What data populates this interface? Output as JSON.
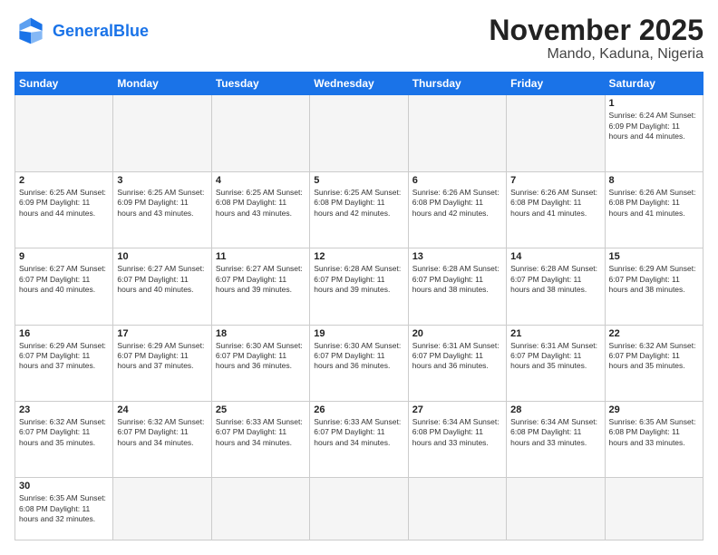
{
  "header": {
    "logo_general": "General",
    "logo_blue": "Blue",
    "month": "November 2025",
    "location": "Mando, Kaduna, Nigeria"
  },
  "days_of_week": [
    "Sunday",
    "Monday",
    "Tuesday",
    "Wednesday",
    "Thursday",
    "Friday",
    "Saturday"
  ],
  "weeks": [
    [
      {
        "day": "",
        "info": ""
      },
      {
        "day": "",
        "info": ""
      },
      {
        "day": "",
        "info": ""
      },
      {
        "day": "",
        "info": ""
      },
      {
        "day": "",
        "info": ""
      },
      {
        "day": "",
        "info": ""
      },
      {
        "day": "1",
        "info": "Sunrise: 6:24 AM\nSunset: 6:09 PM\nDaylight: 11 hours and 44 minutes."
      }
    ],
    [
      {
        "day": "2",
        "info": "Sunrise: 6:25 AM\nSunset: 6:09 PM\nDaylight: 11 hours and 44 minutes."
      },
      {
        "day": "3",
        "info": "Sunrise: 6:25 AM\nSunset: 6:09 PM\nDaylight: 11 hours and 43 minutes."
      },
      {
        "day": "4",
        "info": "Sunrise: 6:25 AM\nSunset: 6:08 PM\nDaylight: 11 hours and 43 minutes."
      },
      {
        "day": "5",
        "info": "Sunrise: 6:25 AM\nSunset: 6:08 PM\nDaylight: 11 hours and 42 minutes."
      },
      {
        "day": "6",
        "info": "Sunrise: 6:26 AM\nSunset: 6:08 PM\nDaylight: 11 hours and 42 minutes."
      },
      {
        "day": "7",
        "info": "Sunrise: 6:26 AM\nSunset: 6:08 PM\nDaylight: 11 hours and 41 minutes."
      },
      {
        "day": "8",
        "info": "Sunrise: 6:26 AM\nSunset: 6:08 PM\nDaylight: 11 hours and 41 minutes."
      }
    ],
    [
      {
        "day": "9",
        "info": "Sunrise: 6:27 AM\nSunset: 6:07 PM\nDaylight: 11 hours and 40 minutes."
      },
      {
        "day": "10",
        "info": "Sunrise: 6:27 AM\nSunset: 6:07 PM\nDaylight: 11 hours and 40 minutes."
      },
      {
        "day": "11",
        "info": "Sunrise: 6:27 AM\nSunset: 6:07 PM\nDaylight: 11 hours and 39 minutes."
      },
      {
        "day": "12",
        "info": "Sunrise: 6:28 AM\nSunset: 6:07 PM\nDaylight: 11 hours and 39 minutes."
      },
      {
        "day": "13",
        "info": "Sunrise: 6:28 AM\nSunset: 6:07 PM\nDaylight: 11 hours and 38 minutes."
      },
      {
        "day": "14",
        "info": "Sunrise: 6:28 AM\nSunset: 6:07 PM\nDaylight: 11 hours and 38 minutes."
      },
      {
        "day": "15",
        "info": "Sunrise: 6:29 AM\nSunset: 6:07 PM\nDaylight: 11 hours and 38 minutes."
      }
    ],
    [
      {
        "day": "16",
        "info": "Sunrise: 6:29 AM\nSunset: 6:07 PM\nDaylight: 11 hours and 37 minutes."
      },
      {
        "day": "17",
        "info": "Sunrise: 6:29 AM\nSunset: 6:07 PM\nDaylight: 11 hours and 37 minutes."
      },
      {
        "day": "18",
        "info": "Sunrise: 6:30 AM\nSunset: 6:07 PM\nDaylight: 11 hours and 36 minutes."
      },
      {
        "day": "19",
        "info": "Sunrise: 6:30 AM\nSunset: 6:07 PM\nDaylight: 11 hours and 36 minutes."
      },
      {
        "day": "20",
        "info": "Sunrise: 6:31 AM\nSunset: 6:07 PM\nDaylight: 11 hours and 36 minutes."
      },
      {
        "day": "21",
        "info": "Sunrise: 6:31 AM\nSunset: 6:07 PM\nDaylight: 11 hours and 35 minutes."
      },
      {
        "day": "22",
        "info": "Sunrise: 6:32 AM\nSunset: 6:07 PM\nDaylight: 11 hours and 35 minutes."
      }
    ],
    [
      {
        "day": "23",
        "info": "Sunrise: 6:32 AM\nSunset: 6:07 PM\nDaylight: 11 hours and 35 minutes."
      },
      {
        "day": "24",
        "info": "Sunrise: 6:32 AM\nSunset: 6:07 PM\nDaylight: 11 hours and 34 minutes."
      },
      {
        "day": "25",
        "info": "Sunrise: 6:33 AM\nSunset: 6:07 PM\nDaylight: 11 hours and 34 minutes."
      },
      {
        "day": "26",
        "info": "Sunrise: 6:33 AM\nSunset: 6:07 PM\nDaylight: 11 hours and 34 minutes."
      },
      {
        "day": "27",
        "info": "Sunrise: 6:34 AM\nSunset: 6:08 PM\nDaylight: 11 hours and 33 minutes."
      },
      {
        "day": "28",
        "info": "Sunrise: 6:34 AM\nSunset: 6:08 PM\nDaylight: 11 hours and 33 minutes."
      },
      {
        "day": "29",
        "info": "Sunrise: 6:35 AM\nSunset: 6:08 PM\nDaylight: 11 hours and 33 minutes."
      }
    ],
    [
      {
        "day": "30",
        "info": "Sunrise: 6:35 AM\nSunset: 6:08 PM\nDaylight: 11 hours and 32 minutes."
      },
      {
        "day": "",
        "info": ""
      },
      {
        "day": "",
        "info": ""
      },
      {
        "day": "",
        "info": ""
      },
      {
        "day": "",
        "info": ""
      },
      {
        "day": "",
        "info": ""
      },
      {
        "day": "",
        "info": ""
      }
    ]
  ]
}
